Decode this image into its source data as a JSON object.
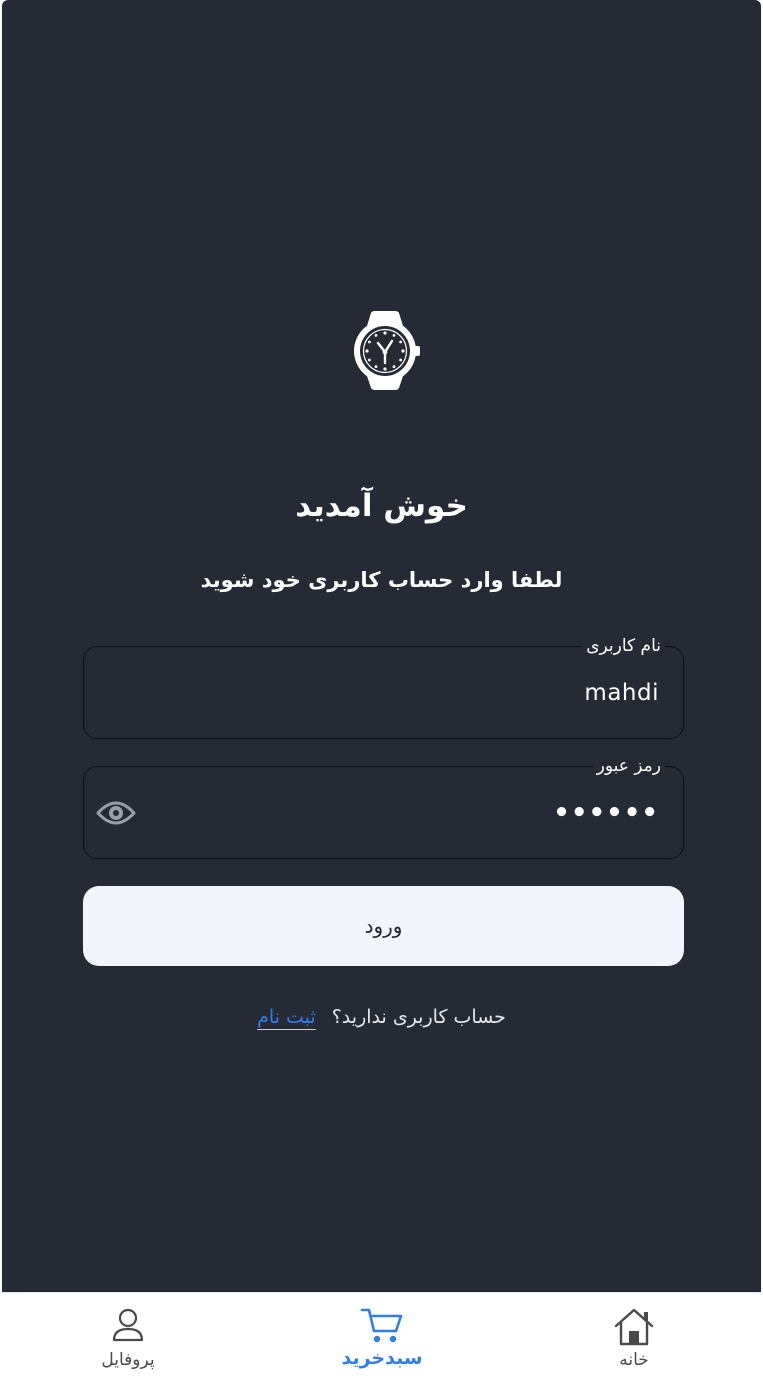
{
  "login": {
    "title": "خوش آمدید",
    "subtitle": "لطفا وارد حساب کاربری خود شوید",
    "username": {
      "label": "نام کاربری",
      "value": "mahdi"
    },
    "password": {
      "label": "رمز عبور",
      "value": "••••••"
    },
    "login_button": "ورود",
    "signup_question": "حساب کاربری ندارید؟",
    "signup_link": "ثبت نام"
  },
  "bottom_nav": {
    "items": [
      {
        "label": "خانه",
        "icon": "home-icon",
        "active": false
      },
      {
        "label": "سبدخرید",
        "icon": "cart-icon",
        "active": true
      },
      {
        "label": "پروفایل",
        "icon": "user-icon",
        "active": false
      }
    ],
    "active_color": "#2f7ef0",
    "inactive_color": "#4a4a4e"
  },
  "colors": {
    "background": "#262a35",
    "button_background": "#f2f5fc",
    "link": "#2f7ef0"
  }
}
